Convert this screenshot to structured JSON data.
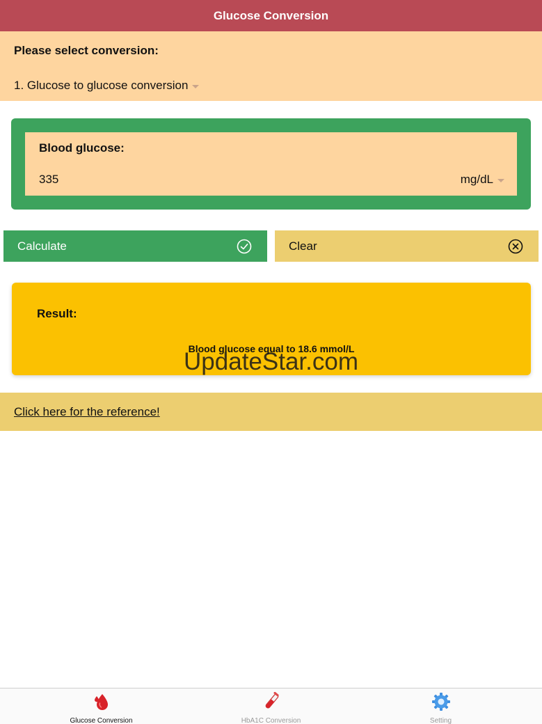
{
  "header": {
    "title": "Glucose Conversion"
  },
  "conversion": {
    "label": "Please select conversion:",
    "selected": "1. Glucose to glucose conversion"
  },
  "blood_glucose": {
    "label": "Blood glucose:",
    "value": "335",
    "unit": "mg/dL"
  },
  "buttons": {
    "calculate": "Calculate",
    "clear": "Clear"
  },
  "result": {
    "label": "Result:",
    "text": "Blood glucose equal to 18.6 mmol/L"
  },
  "watermark": "UpdateStar.com",
  "reference_link": "Click here for the reference!",
  "tabs": [
    {
      "label": "Glucose Conversion",
      "icon": "blood-drop-icon",
      "active": true
    },
    {
      "label": "HbA1C Conversion",
      "icon": "test-tube-icon",
      "active": false
    },
    {
      "label": "Setting",
      "icon": "gear-icon",
      "active": false
    }
  ],
  "colors": {
    "navbar": "#b94a55",
    "panel": "#fed59f",
    "green": "#3da35d",
    "yellow": "#ecce70",
    "result": "#fbc101"
  }
}
